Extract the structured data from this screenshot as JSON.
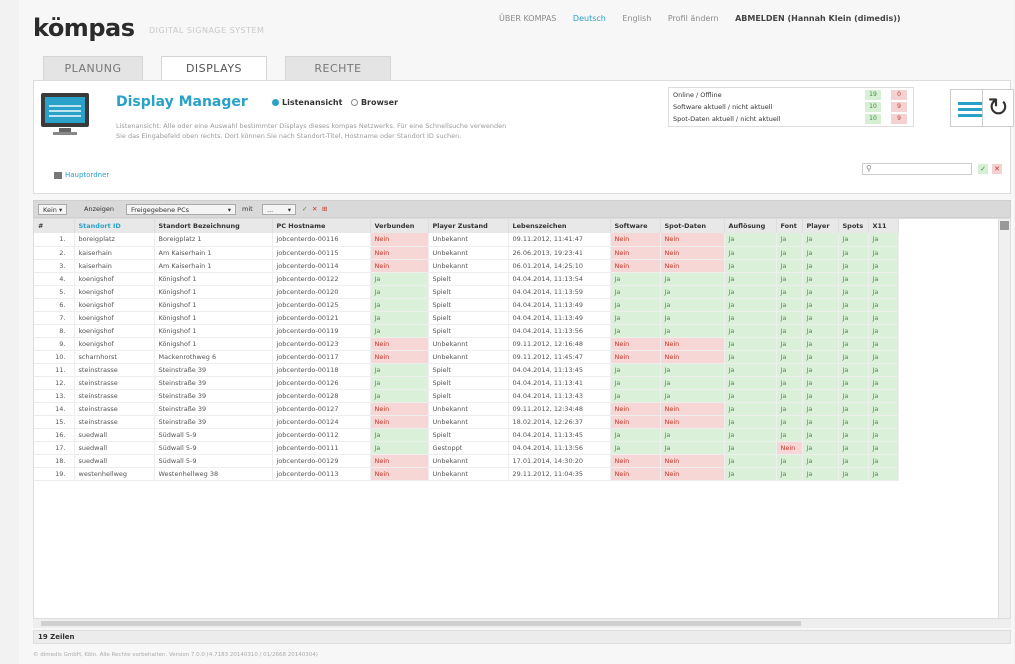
{
  "header": {
    "logo": "kömpas",
    "logo_sub": "DIGITAL SIGNAGE SYSTEM",
    "nav": [
      {
        "label": "ÜBER KOMPAS",
        "active": false
      },
      {
        "label": "Deutsch",
        "active": true
      },
      {
        "label": "English",
        "active": false
      },
      {
        "label": "Profil ändern",
        "active": false
      }
    ],
    "logout": "ABMELDEN (Hannah Klein (dimedis))"
  },
  "tabs": [
    {
      "label": "PLANUNG",
      "active": false
    },
    {
      "label": "DISPLAYS",
      "active": true
    },
    {
      "label": "RECHTE",
      "active": false
    }
  ],
  "panel": {
    "title": "Display Manager",
    "view_list": "Listenansicht",
    "view_browser": "Browser",
    "description": "Listenansicht: Alle oder eine Auswahl bestimmter Displays dieses kompas Netzwerks. Für eine Schnellsuche verwenden Sie das Eingabefeld oben rechts. Dort können Sie nach Standort-Titel, Hostname oder Standort ID suchen.",
    "folder_link": "Hauptordner",
    "status": [
      {
        "label": "Online / Offline",
        "green": "19",
        "red": "0"
      },
      {
        "label": "Software aktuell / nicht aktuell",
        "green": "10",
        "red": "9"
      },
      {
        "label": "Spot-Daten aktuell / nicht aktuell",
        "green": "10",
        "red": "9"
      }
    ],
    "search_placeholder": ""
  },
  "toolbar": {
    "kein": "Kein",
    "anzeigen": "Anzeigen",
    "filter_select": "Freigegebene PCs",
    "mit": "mit",
    "mit_select": "..."
  },
  "table": {
    "columns": [
      "#",
      "Standort ID",
      "Standort Bezeichnung",
      "PC Hostname",
      "Verbunden",
      "Player Zustand",
      "Lebenszeichen",
      "Software",
      "Spot-Daten",
      "Auflösung",
      "Font",
      "Player",
      "Spots",
      "X11"
    ],
    "rows": [
      [
        "1.",
        "boreigplatz",
        "Boreigplatz 1",
        "jobcenterdo-00116",
        "Nein",
        "Unbekannt",
        "09.11.2012, 11:41:47",
        "Nein",
        "Nein",
        "Ja",
        "Ja",
        "Ja",
        "Ja",
        "Ja"
      ],
      [
        "2.",
        "kaiserhain",
        "Am Kaiserhain 1",
        "jobcenterdo-00115",
        "Nein",
        "Unbekannt",
        "26.06.2013, 19:23:41",
        "Nein",
        "Nein",
        "Ja",
        "Ja",
        "Ja",
        "Ja",
        "Ja"
      ],
      [
        "3.",
        "kaiserhain",
        "Am Kaiserhain 1",
        "jobcenterdo-00114",
        "Nein",
        "Unbekannt",
        "06.01.2014, 14:25:10",
        "Nein",
        "Nein",
        "Ja",
        "Ja",
        "Ja",
        "Ja",
        "Ja"
      ],
      [
        "4.",
        "koenigshof",
        "Königshof 1",
        "jobcenterdo-00122",
        "Ja",
        "Spielt",
        "04.04.2014, 11:13:54",
        "Ja",
        "Ja",
        "Ja",
        "Ja",
        "Ja",
        "Ja",
        "Ja"
      ],
      [
        "5.",
        "koenigshof",
        "Königshof 1",
        "jobcenterdo-00120",
        "Ja",
        "Spielt",
        "04.04.2014, 11:13:59",
        "Ja",
        "Ja",
        "Ja",
        "Ja",
        "Ja",
        "Ja",
        "Ja"
      ],
      [
        "6.",
        "koenigshof",
        "Königshof 1",
        "jobcenterdo-00125",
        "Ja",
        "Spielt",
        "04.04.2014, 11:13:49",
        "Ja",
        "Ja",
        "Ja",
        "Ja",
        "Ja",
        "Ja",
        "Ja"
      ],
      [
        "7.",
        "koenigshof",
        "Königshof 1",
        "jobcenterdo-00121",
        "Ja",
        "Spielt",
        "04.04.2014, 11:13:49",
        "Ja",
        "Ja",
        "Ja",
        "Ja",
        "Ja",
        "Ja",
        "Ja"
      ],
      [
        "8.",
        "koenigshof",
        "Königshof 1",
        "jobcenterdo-00119",
        "Ja",
        "Spielt",
        "04.04.2014, 11:13:56",
        "Ja",
        "Ja",
        "Ja",
        "Ja",
        "Ja",
        "Ja",
        "Ja"
      ],
      [
        "9.",
        "koenigshof",
        "Königshof 1",
        "jobcenterdo-00123",
        "Nein",
        "Unbekannt",
        "09.11.2012, 12:16:48",
        "Nein",
        "Nein",
        "Ja",
        "Ja",
        "Ja",
        "Ja",
        "Ja"
      ],
      [
        "10.",
        "scharnhorst",
        "Mackenrothweg 6",
        "jobcenterdo-00117",
        "Nein",
        "Unbekannt",
        "09.11.2012, 11:45:47",
        "Nein",
        "Nein",
        "Ja",
        "Ja",
        "Ja",
        "Ja",
        "Ja"
      ],
      [
        "11.",
        "steinstrasse",
        "Steinstraße 39",
        "jobcenterdo-00118",
        "Ja",
        "Spielt",
        "04.04.2014, 11:13:45",
        "Ja",
        "Ja",
        "Ja",
        "Ja",
        "Ja",
        "Ja",
        "Ja"
      ],
      [
        "12.",
        "steinstrasse",
        "Steinstraße 39",
        "jobcenterdo-00126",
        "Ja",
        "Spielt",
        "04.04.2014, 11:13:41",
        "Ja",
        "Ja",
        "Ja",
        "Ja",
        "Ja",
        "Ja",
        "Ja"
      ],
      [
        "13.",
        "steinstrasse",
        "Steinstraße 39",
        "jobcenterdo-00128",
        "Ja",
        "Spielt",
        "04.04.2014, 11:13:43",
        "Ja",
        "Ja",
        "Ja",
        "Ja",
        "Ja",
        "Ja",
        "Ja"
      ],
      [
        "14.",
        "steinstrasse",
        "Steinstraße 39",
        "jobcenterdo-00127",
        "Nein",
        "Unbekannt",
        "09.11.2012, 12:34:48",
        "Nein",
        "Nein",
        "Ja",
        "Ja",
        "Ja",
        "Ja",
        "Ja"
      ],
      [
        "15.",
        "steinstrasse",
        "Steinstraße 39",
        "jobcenterdo-00124",
        "Nein",
        "Unbekannt",
        "18.02.2014, 12:26:37",
        "Nein",
        "Nein",
        "Ja",
        "Ja",
        "Ja",
        "Ja",
        "Ja"
      ],
      [
        "16.",
        "suedwall",
        "Südwall 5-9",
        "jobcenterdo-00112",
        "Ja",
        "Spielt",
        "04.04.2014, 11:13:45",
        "Ja",
        "Ja",
        "Ja",
        "Ja",
        "Ja",
        "Ja",
        "Ja"
      ],
      [
        "17.",
        "suedwall",
        "Südwall 5-9",
        "jobcenterdo-00111",
        "Ja",
        "Gestoppt",
        "04.04.2014, 11:13:56",
        "Ja",
        "Ja",
        "Ja",
        "Nein",
        "Ja",
        "Ja",
        "Ja"
      ],
      [
        "18.",
        "suedwall",
        "Südwall 5-9",
        "jobcenterdo-00129",
        "Nein",
        "Unbekannt",
        "17.01.2014, 14:30:20",
        "Nein",
        "Nein",
        "Ja",
        "Ja",
        "Ja",
        "Ja",
        "Ja"
      ],
      [
        "19.",
        "westenhellweg",
        "Westenhellweg 38",
        "jobcenterdo-00113",
        "Nein",
        "Unbekannt",
        "29.11.2012, 11:04:35",
        "Nein",
        "Nein",
        "Ja",
        "Ja",
        "Ja",
        "Ja",
        "Ja"
      ]
    ],
    "row_count_label": "19 Zeilen"
  },
  "footer": {
    "copyright": "© dimedis GmbH, Köln. Alle Rechte vorbehalten. Version 7.0.0 (4.7183 20140310 / 01/2668 20140304)"
  },
  "colors": {
    "accent": "#2aa1c9",
    "ja_bg": "#dbf0d8",
    "nein_bg": "#f7d6d6"
  }
}
